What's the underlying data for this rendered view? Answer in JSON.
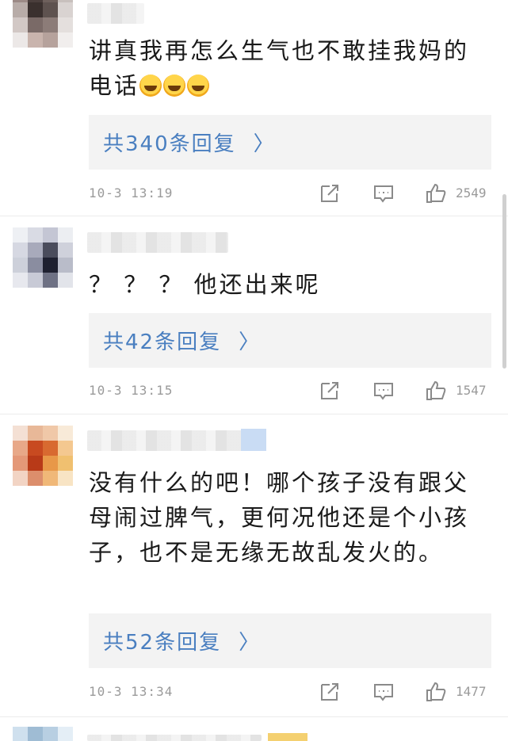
{
  "comments": [
    {
      "text": "讲真我再怎么生气也不敢挂我妈的电话",
      "emoji_count": 3,
      "emoji_name": "laughing-crying-emoji",
      "reply_label": "共340条回复",
      "time": "10-3 13:19",
      "likes": "2549"
    },
    {
      "text": "？ ？ ？ 他还出来呢",
      "reply_label": "共42条回复",
      "time": "10-3 13:15",
      "likes": "1547"
    },
    {
      "text": "没有什么的吧！哪个孩子没有跟父母闹过脾气，更何况他还是个小孩子，也不是无缘无故乱发火的。",
      "reply_label": "共52条回复",
      "time": "10-3 13:34",
      "likes": "1477"
    }
  ],
  "icons": {
    "share": "share-icon",
    "comment": "comment-icon",
    "like": "thumbs-up-icon",
    "chevron": "chevron-right-icon"
  },
  "chevron_glyph": "〉",
  "colors": {
    "reply_link": "#4a7fc0",
    "meta_text": "#9a9a9a",
    "reply_bg": "#f3f3f3"
  }
}
